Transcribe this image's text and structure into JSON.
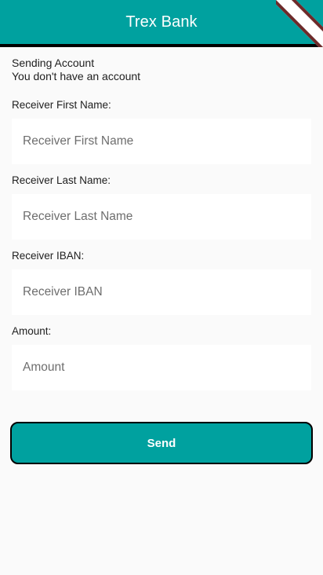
{
  "appbar": {
    "title": "Trex Bank"
  },
  "sending": {
    "title": "Sending Account",
    "status": "You don't have an account"
  },
  "fields": [
    {
      "label": "Receiver First Name:",
      "placeholder": "Receiver First Name",
      "value": ""
    },
    {
      "label": "Receiver Last Name:",
      "placeholder": "Receiver Last Name",
      "value": ""
    },
    {
      "label": "Receiver IBAN:",
      "placeholder": "Receiver IBAN",
      "value": ""
    },
    {
      "label": "Amount:",
      "placeholder": "Amount",
      "value": ""
    }
  ],
  "send_button": {
    "label": "Send"
  },
  "colors": {
    "primary": "#00a19f",
    "background": "#fafafa"
  }
}
